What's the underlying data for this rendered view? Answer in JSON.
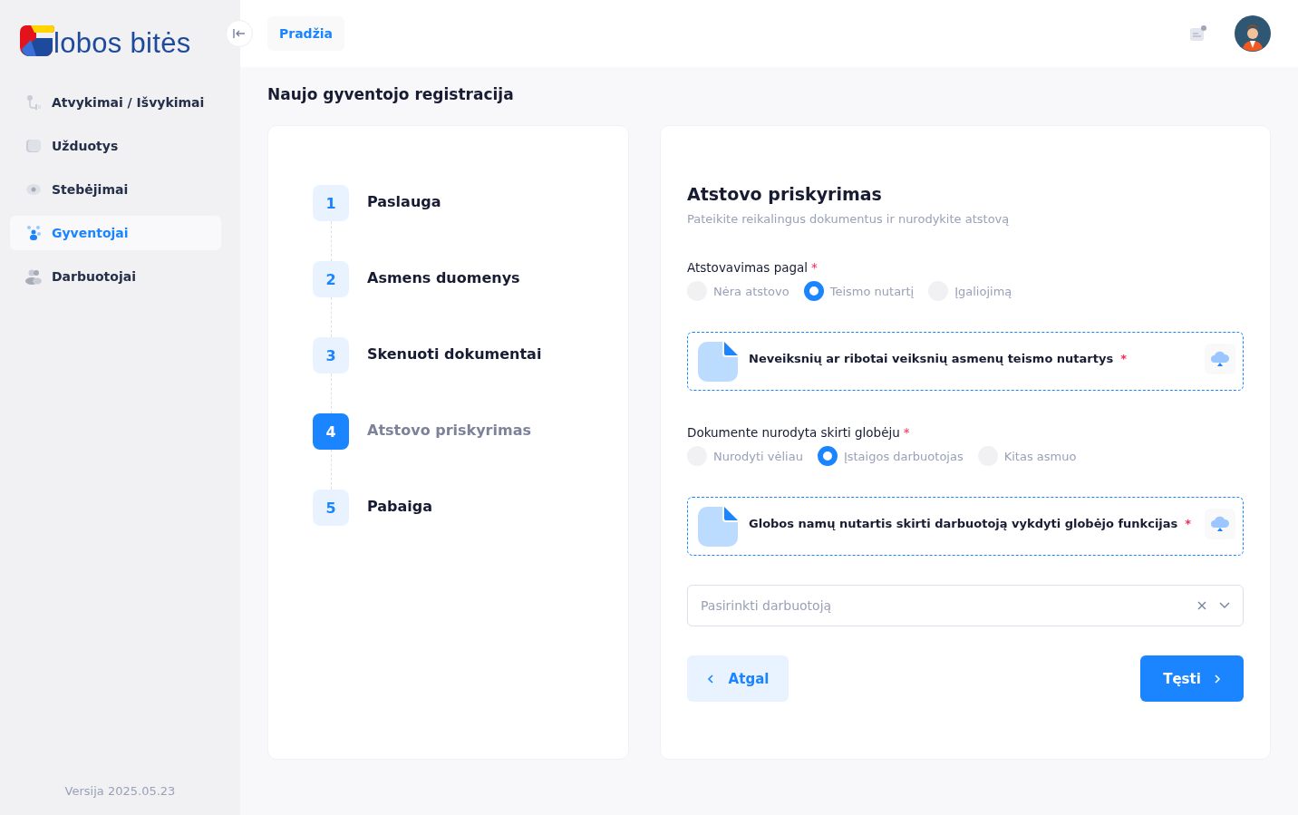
{
  "logo": {
    "text": "lobos bitės"
  },
  "sidebar": {
    "items": [
      {
        "label": "Atvykimai / Išvykimai",
        "selected": false
      },
      {
        "label": "Užduotys",
        "selected": false
      },
      {
        "label": "Stebėjimai",
        "selected": false
      },
      {
        "label": "Gyventojai",
        "selected": true
      },
      {
        "label": "Darbuotojai",
        "selected": false
      }
    ],
    "version": "Versija 2025.05.23"
  },
  "header": {
    "breadcrumb": "Pradžia"
  },
  "page_title": "Naujo gyventojo registracija",
  "steps": [
    {
      "number": "1",
      "label": "Paslauga",
      "selected": false
    },
    {
      "number": "2",
      "label": "Asmens duomenys",
      "selected": false
    },
    {
      "number": "3",
      "label": "Skenuoti dokumentai",
      "selected": false
    },
    {
      "number": "4",
      "label": "Atstovo priskyrimas",
      "selected": true
    },
    {
      "number": "5",
      "label": "Pabaiga",
      "selected": false
    }
  ],
  "form": {
    "title": "Atstovo priskyrimas",
    "subtitle": "Pateikite reikalingus dokumentus ir nurodykite atstovą",
    "sections": [
      {
        "label": "Atstovavimas pagal",
        "required_mark": "*",
        "options": [
          {
            "label": "Nėra atstovo",
            "selected": false
          },
          {
            "label": "Teismo nutartį",
            "selected": true
          },
          {
            "label": "Įgaliojimą",
            "selected": false
          }
        ],
        "upload": {
          "label": "Neveiksnių ar ribotai veiksnių asmenų teismo nutartys",
          "required_mark": "*"
        }
      },
      {
        "label": "Dokumente nurodyta skirti globėju",
        "required_mark": "*",
        "options": [
          {
            "label": "Nurodyti vėliau",
            "selected": false
          },
          {
            "label": "Įstaigos darbuotojas",
            "selected": true
          },
          {
            "label": "Kitas asmuo",
            "selected": false
          }
        ],
        "upload": {
          "label": "Globos namų nutartis skirti darbuotoją vykdyti globėjo funkcijas",
          "required_mark": "*"
        }
      }
    ],
    "select": {
      "placeholder": "Pasirinkti darbuotoją"
    },
    "back_button": "Atgal",
    "next_button": "Tęsti"
  }
}
